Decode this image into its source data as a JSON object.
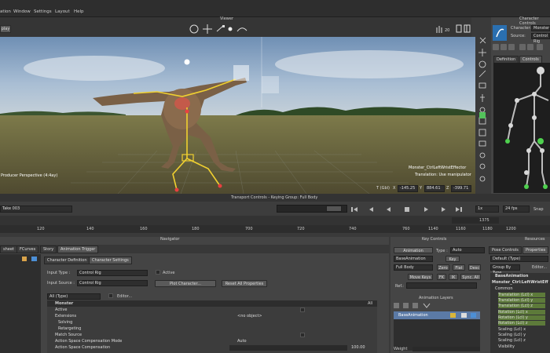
{
  "menu": [
    "ation",
    "Window",
    "Settings",
    "Layout",
    "Help"
  ],
  "viewer": {
    "title": "Viewer",
    "left_tag": "play",
    "num_display": "20",
    "producer_label": "Producer Perspective (4:4ay)",
    "hud_line1": "Monster_CtrlLeftWristEffector",
    "hud_line2": "Translation: Use manipulator",
    "coord_label": "T (Gbl)",
    "x_label": "X",
    "x_value": "-145.25",
    "y_label": "Y",
    "y_value": "884.61",
    "z_label": "Z",
    "z_value": "-399.71"
  },
  "character_controls": {
    "title": "Character Controls",
    "character_label": "Character:",
    "character_value": "Monster",
    "source_label": "Source:",
    "source_value": "Control Rig",
    "tabs": [
      "Definition",
      "Controls"
    ]
  },
  "transport": {
    "title": "Transport Controls - Keying Group: Full Body",
    "take": "Take 003",
    "speed": "1x",
    "fps": "24 fps",
    "snap": "Snap",
    "end_frame": "1375",
    "ruler": [
      "120",
      "140",
      "160",
      "180",
      "700",
      "720",
      "740",
      "760",
      "1140",
      "1160",
      "1180",
      "1200"
    ]
  },
  "navigator": {
    "title": "Navigator",
    "tabs": [
      "sheet",
      "FCurves",
      "Story",
      "Animation Trigger"
    ],
    "inner_tabs": [
      "Character Definition",
      "Character Settings"
    ],
    "input_type_label": "Input Type :",
    "input_type_value": "Control Rig",
    "active_label": "Active",
    "input_source_label": "Input Source :",
    "input_source_value": "Control Rig",
    "plot_button": "Plot Character...",
    "reset_button": "Reset All Properties",
    "filter_value": "All (Type)",
    "editor_label": "Editor...",
    "tree_header": "Monster",
    "tree_all": "All",
    "rows": [
      {
        "label": "Active",
        "value": ""
      },
      {
        "label": "Extensions",
        "value": "<no object>"
      },
      {
        "label": "Solving",
        "value": ""
      },
      {
        "label": "Retargeting",
        "value": ""
      },
      {
        "label": "Match Source",
        "value": ""
      },
      {
        "label": "Action Space Compensation Mode",
        "value": "Auto"
      },
      {
        "label": "Action Space Compensation",
        "value": "100.00"
      }
    ]
  },
  "key_controls": {
    "title": "Key Controls",
    "animation_button": "Animation",
    "type_label": "Type :",
    "type_value": "Auto",
    "base_animation": "BaseAnimation",
    "key_button": "Key",
    "full_body": "Full Body",
    "zero_button": "Zero",
    "flat_button": "Flat",
    "desc_button": "Desc",
    "move_keys": "Move Keys",
    "fk_button": "FK",
    "ik_button": "IK",
    "sync_button": "Sync. All",
    "ref_label": "Ref.:"
  },
  "animation_layers": {
    "title": "Animation Layers",
    "layer": "BaseAnimation",
    "weight_label": "Weight"
  },
  "resources": {
    "title": "Resources",
    "tabs": [
      "Pose Controls",
      "Properties"
    ],
    "default_type": "Default (Type)",
    "group_by": "Group By Type",
    "editor": "Editor...",
    "items": [
      "BaseAnimation",
      "Monster_Ctrl:LeftWristEff",
      "Common",
      "Translation (Lcl) x",
      "Translation (Lcl) y",
      "Translation (Lcl) z",
      "Rotation (Lcl) x",
      "Rotation (Lcl) y",
      "Rotation (Lcl) z",
      "Scaling (Lcl) x",
      "Scaling (Lcl) y",
      "Scaling (Lcl) z",
      "Visibility"
    ]
  }
}
